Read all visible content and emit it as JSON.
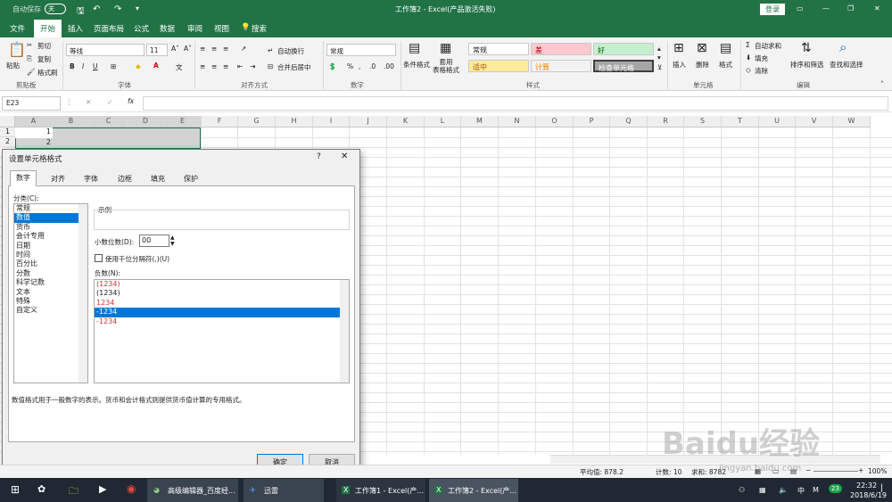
{
  "title_bar": {
    "autosave_label": "自动保存",
    "autosave_state": "关",
    "doc_title": "工作簿2 - Excel(产品激活失败)",
    "login_label": "登录"
  },
  "menu": {
    "items": [
      "文件",
      "开始",
      "插入",
      "页面布局",
      "公式",
      "数据",
      "审阅",
      "视图"
    ],
    "active": "开始",
    "tell_me": "搜索"
  },
  "ribbon": {
    "clipboard": {
      "paste": "粘贴",
      "cut": "剪切",
      "copy": "复制",
      "painter": "格式刷",
      "group": "剪贴板"
    },
    "font": {
      "name": "等线",
      "size": "11",
      "group": "字体",
      "bold": "B",
      "italic": "I",
      "underline": "U"
    },
    "align": {
      "wrap": "自动换行",
      "merge": "合并后居中",
      "group": "对齐方式"
    },
    "number": {
      "format": "常规",
      "group": "数字"
    },
    "styles": {
      "cond": "条件格式",
      "table": "套用\n表格格式",
      "group": "样式",
      "cells": [
        "常规",
        "差",
        "好",
        "适中",
        "计算",
        "检查单元格"
      ]
    },
    "cells_grp": {
      "insert": "插入",
      "delete": "删除",
      "format": "格式",
      "group": "单元格"
    },
    "edit": {
      "autosum": "自动求和",
      "fill": "填充",
      "clear": "清除",
      "sort": "排序和筛选",
      "find": "查找和选择",
      "group": "编辑"
    }
  },
  "formula_bar": {
    "name_box": "E23",
    "fx": "fx"
  },
  "sheet": {
    "columns": [
      "A",
      "B",
      "C",
      "D",
      "E",
      "F",
      "G",
      "H",
      "I",
      "J",
      "K",
      "L",
      "M",
      "N",
      "O",
      "P",
      "Q",
      "R",
      "S",
      "T",
      "U",
      "V",
      "W"
    ],
    "rows": [
      "1",
      "2"
    ],
    "a1": "1",
    "a2": "2"
  },
  "dialog": {
    "title": "设置单元格格式",
    "help": "?",
    "close": "✕",
    "tabs": [
      "数字",
      "对齐",
      "字体",
      "边框",
      "填充",
      "保护"
    ],
    "category_label": "分类(C):",
    "categories": [
      "常规",
      "数值",
      "货币",
      "会计专用",
      "日期",
      "时间",
      "百分比",
      "分数",
      "科学记数",
      "文本",
      "特殊",
      "自定义"
    ],
    "selected_category": "数值",
    "sample_label": "示例",
    "decimal_label": "小数位数(D):",
    "decimal_value": "00",
    "thousands_label": "使用千位分隔符(,)(U)",
    "negative_label": "负数(N):",
    "negatives": [
      "(1234)",
      "(1234)",
      "1234",
      "-1234",
      "-1234"
    ],
    "description": "数值格式用于一般数字的表示。货币和会计格式则提供货币值计算的专用格式。",
    "ok": "确定",
    "cancel": "取消"
  },
  "status_bar": {
    "average": "平均值: 878.2",
    "count": "计数: 10",
    "sum": "求和: 8782",
    "zoom": "100%"
  },
  "taskbar": {
    "items": [
      "高级编辑器_百度经...",
      "迅雷",
      "工作簿1 - Excel(产...",
      "工作簿2 - Excel(产..."
    ],
    "time": "22:32",
    "date": "2018/6/19",
    "badge": "23"
  },
  "watermark": {
    "text": "Baidu经验",
    "url": "jingyan.baidu.com"
  },
  "colors": {
    "excel_green": "#217346",
    "select_blue": "#0078d7",
    "neg_red": "#d13438"
  }
}
